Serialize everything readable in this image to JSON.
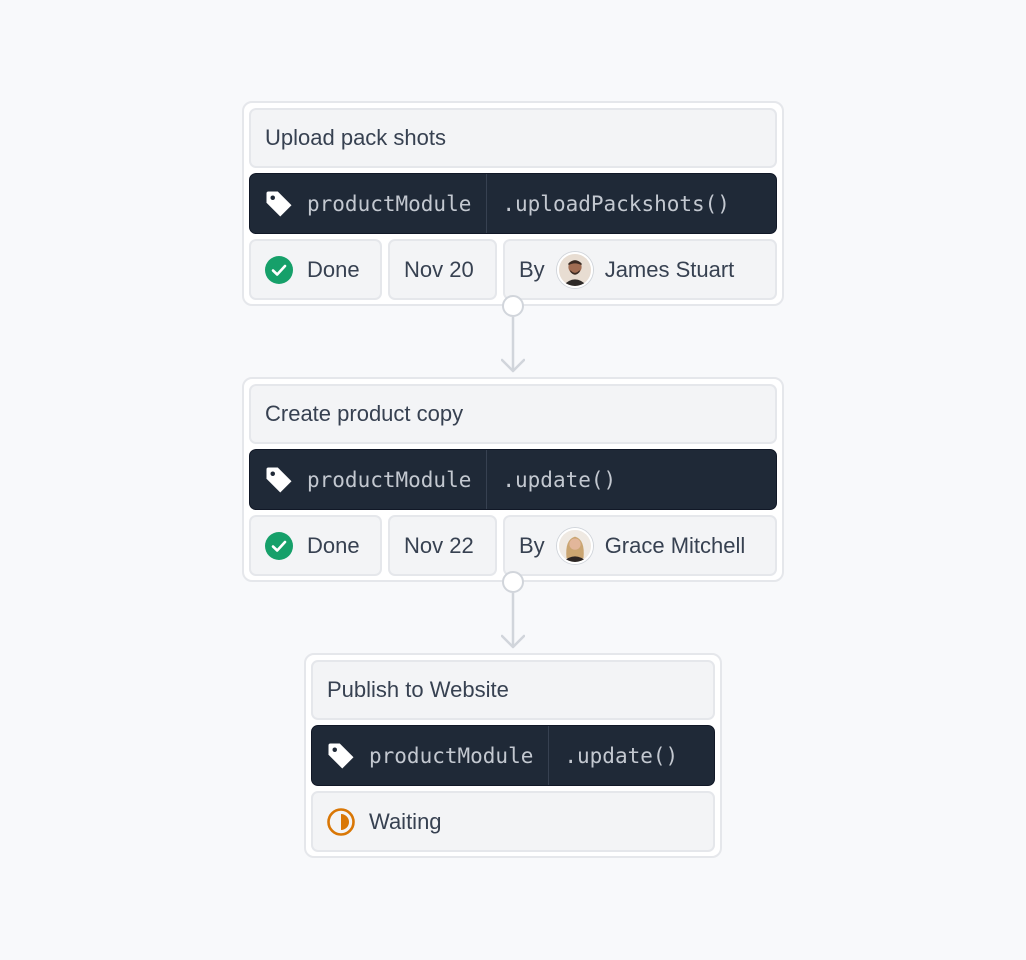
{
  "steps": [
    {
      "title": "Upload pack shots",
      "module": "productModule",
      "method": ".uploadPackshots()",
      "status": "Done",
      "date": "Nov 20",
      "by_label": "By",
      "assignee": "James Stuart"
    },
    {
      "title": "Create product copy",
      "module": "productModule",
      "method": ".update()",
      "status": "Done",
      "date": "Nov 22",
      "by_label": "By",
      "assignee": "Grace Mitchell"
    },
    {
      "title": "Publish to Website",
      "module": "productModule",
      "method": ".update()",
      "status": "Waiting"
    }
  ],
  "icons": {
    "tag": "tag-icon",
    "done": "check-circle-icon",
    "waiting": "half-circle-icon"
  },
  "colors": {
    "background": "#f8f9fb",
    "code_bg": "#1f2937",
    "done": "#16a06a",
    "waiting": "#d97706"
  }
}
